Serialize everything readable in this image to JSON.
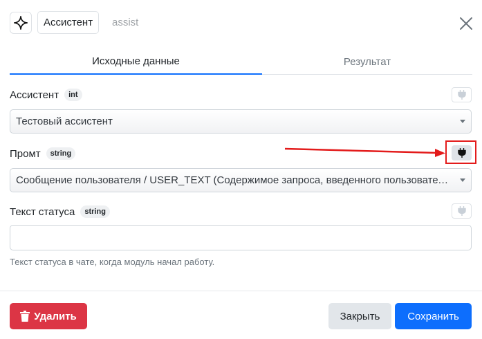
{
  "header": {
    "title": "Ассистент",
    "subtitle": "assist"
  },
  "tabs": [
    {
      "label": "Исходные данные",
      "active": true
    },
    {
      "label": "Результат",
      "active": false
    }
  ],
  "fields": {
    "assistant": {
      "label": "Ассистент",
      "type": "int",
      "value": "Тестовый ассистент"
    },
    "prompt": {
      "label": "Промт",
      "type": "string",
      "value": "Сообщение пользователя / USER_TEXT (Содержимое запроса, введенного пользователем)"
    },
    "status_text": {
      "label": "Текст статуса",
      "type": "string",
      "value": "",
      "help": "Текст статуса в чате, когда модуль начал работу."
    }
  },
  "footer": {
    "delete_label": "Удалить",
    "close_label": "Закрыть",
    "save_label": "Сохранить"
  },
  "colors": {
    "accent": "#0d6efd",
    "danger": "#dc3545",
    "annotation": "#e31b1b"
  }
}
